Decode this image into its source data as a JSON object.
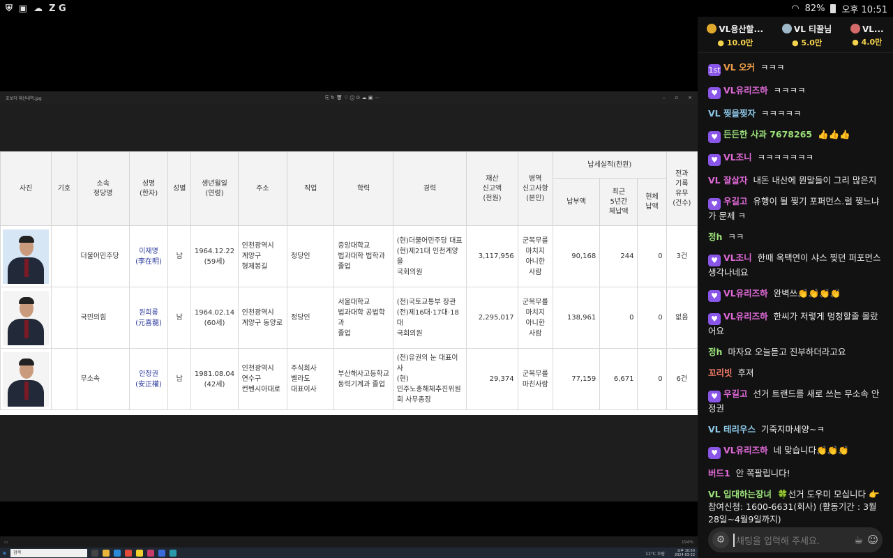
{
  "status_bar": {
    "battery": "82%",
    "time": "오후 10:51",
    "left_letters": "Z G"
  },
  "viewer": {
    "filename": "호보자 재산내역.jpg",
    "zoom": "194%",
    "tools": "⎘ ↻ 🗑 ♡ ⓘ ⊙ ☁ ▣ ⋯"
  },
  "table": {
    "headers": {
      "photo": "사진",
      "symbol": "기호",
      "party": "소속\n정당명",
      "name": "성명\n(한자)",
      "gender": "성별",
      "birth": "생년월일\n(연령)",
      "address": "주소",
      "job": "직업",
      "edu": "학력",
      "career": "경력",
      "asset": "재산\n신고액\n(천원)",
      "military": "병역\n신고사항\n(본인)",
      "tax_group": "납세실적(천원)",
      "tax_paid": "납부액",
      "tax_5y": "최근\n5년간\n체납액",
      "tax_now": "현체\n납액",
      "crime": "전과\n기록\n유무\n(건수)"
    },
    "rows": [
      {
        "party": "더불어민주당",
        "name": "이재명\n(李在明)",
        "gender": "남",
        "birth": "1964.12.22\n(59세)",
        "address": "인천광역시\n계양구\n형제봉길",
        "job": "정당인",
        "edu": "중앙대학교\n법과대학 법학과\n졸업",
        "career": "(현)더불어민주당 대표\n(현)제21대 인천계양을\n국회의원",
        "asset": "3,117,956",
        "military": "군복무를\n마치지\n아니한\n사람",
        "tax_paid": "90,168",
        "tax_5y": "244",
        "tax_now": "0",
        "crime": "3건"
      },
      {
        "party": "국민의힘",
        "name": "원희룡\n(元喜龍)",
        "gender": "남",
        "birth": "1964.02.14\n(60세)",
        "address": "인천광역시\n계양구 동양로",
        "job": "정당인",
        "edu": "서울대학교\n법과대학 공법학과\n졸업",
        "career": "(전)국토교통부 장관\n(전)제16대·17대·18대\n국회의원",
        "asset": "2,295,017",
        "military": "군복무를\n마치지\n아니한\n사람",
        "tax_paid": "138,961",
        "tax_5y": "0",
        "tax_now": "0",
        "crime": "없음"
      },
      {
        "party": "무소속",
        "name": "안정권\n(安正權)",
        "gender": "남",
        "birth": "1981.08.04\n(42세)",
        "address": "인천광역시\n연수구\n컨벤시아대로",
        "job": "주식회사\n벨라도\n대표이사",
        "edu": "부산해사고등학교\n동력기계과 졸업",
        "career": "(전)유권의 눈 대표이사\n(현)\n민주노총해체추진위원\n회 사무총장",
        "asset": "29,374",
        "military": "군복무를\n마친사람",
        "tax_paid": "77,159",
        "tax_5y": "6,671",
        "tax_now": "0",
        "crime": "6건"
      }
    ]
  },
  "taskbar": {
    "search": "검색",
    "weather": "11°C 흐림",
    "clock": "오후 10:50\n2024-03-22"
  },
  "chat": {
    "donors": [
      {
        "name": "VL용산할...",
        "amount": "10.0만",
        "color": "#e0a92c"
      },
      {
        "name": "VL 티끌님",
        "amount": "5.0만",
        "color": "#9fb8c8"
      },
      {
        "name": "VL...",
        "amount": "4.0만",
        "color": "#d46a6a"
      }
    ],
    "messages": [
      {
        "user": "VL 오커",
        "color": "#f0a04a",
        "badge": "1st",
        "text": "ㅋㅋㅋ"
      },
      {
        "user": "VL유리즈하",
        "color": "#e06ad8",
        "badge": "♥",
        "text": "ㅋㅋㅋㅋ"
      },
      {
        "user": "VL 찢을찢자",
        "color": "#8ec8e8",
        "badge": "",
        "text": "ㅋㅋㅋㅋㅋ"
      },
      {
        "user": "든든한 사과 7678265",
        "color": "#9be07a",
        "badge": "♥",
        "text": "👍👍👍"
      },
      {
        "user": "VL조니",
        "color": "#e06ad8",
        "badge": "♥",
        "text": "ㅋㅋㅋㅋㅋㅋㅋ"
      },
      {
        "user": "VL 잘살자",
        "color": "#e06ad8",
        "badge": "",
        "text": "내돈 내산에 뭔말들이 그리 많은지"
      },
      {
        "user": "우길고",
        "color": "#e06ad8",
        "badge": "♥",
        "text": "유행이 될 찢기 포퍼먼스.럴 찢느냐가 문제 ㅋ"
      },
      {
        "user": "정h",
        "color": "#9be07a",
        "badge": "",
        "text": "ㅋㅋ"
      },
      {
        "user": "VL조니",
        "color": "#e06ad8",
        "badge": "♥",
        "text": "한때 옥택연이 샤스 찢던 퍼포먼스 생각나네요"
      },
      {
        "user": "VL유리즈하",
        "color": "#e06ad8",
        "badge": "♥",
        "text": "완벽쓰👏👏👏👏"
      },
      {
        "user": "VL유리즈하",
        "color": "#e06ad8",
        "badge": "♥",
        "text": "한씨가 저렇게 멍청할줄 몰랐어요"
      },
      {
        "user": "정h",
        "color": "#9be07a",
        "badge": "",
        "text": "마자요 오늘듣고 진부하더라고요"
      },
      {
        "user": "꼬리빗",
        "color": "#f07a6a",
        "badge": "",
        "text": "후져"
      },
      {
        "user": "우길고",
        "color": "#e06ad8",
        "badge": "♥",
        "text": "선거 트랜드를 새로 쓰는 무소속 안정권"
      },
      {
        "user": "VL 테리우스",
        "color": "#8ec8e8",
        "badge": "",
        "text": "기죽지마세양~ㅋ"
      },
      {
        "user": "VL유리즈하",
        "color": "#e06ad8",
        "badge": "♥",
        "text": "네 맞습니다👏👏👏"
      },
      {
        "user": "버드1",
        "color": "#e06ad8",
        "badge": "",
        "text": "안 쪽팔립니다!"
      },
      {
        "user": "VL 입대하는장녀",
        "color": "#9be07a",
        "badge": "",
        "text": "🍀선거 도우미 모십니다 👉참여신청: 1600-6631(회사) (활동기간 : 3월28일~4월9일까지)"
      }
    ],
    "input_placeholder": "채팅을 입력해 주세요."
  }
}
